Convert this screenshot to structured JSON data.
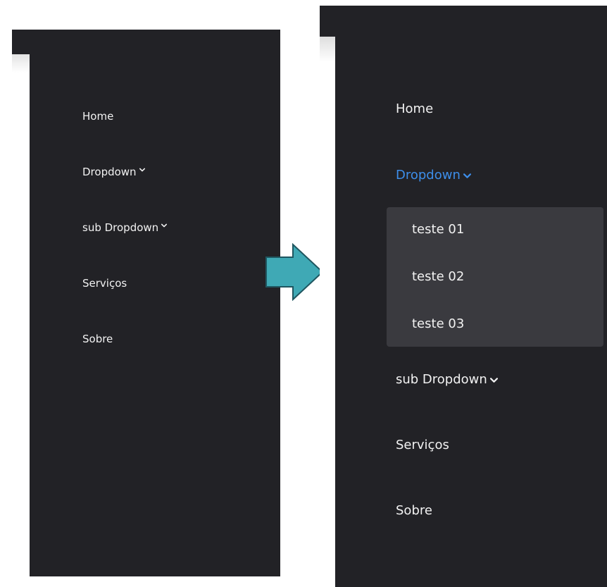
{
  "before": {
    "menu": [
      {
        "label": "Home",
        "has_chevron": false
      },
      {
        "label": "Dropdown",
        "has_chevron": true
      },
      {
        "label": "sub Dropdown",
        "has_chevron": true
      },
      {
        "label": "Serviços",
        "has_chevron": false
      },
      {
        "label": "Sobre",
        "has_chevron": false
      }
    ]
  },
  "after": {
    "menu": [
      {
        "label": "Home",
        "has_chevron": false
      },
      {
        "label": "Dropdown",
        "has_chevron": true,
        "active": true
      },
      {
        "label": "sub Dropdown",
        "has_chevron": true
      },
      {
        "label": "Serviços",
        "has_chevron": false
      },
      {
        "label": "Sobre",
        "has_chevron": false
      }
    ],
    "dropdown_items": [
      "teste 01",
      "teste 02",
      "teste 03"
    ]
  },
  "colors": {
    "panel_bg": "#222226",
    "dropdown_bg": "#3a3a3f",
    "text": "#f2f2f2",
    "active_text": "#3d8eea",
    "arrow_fill": "#3fa9b5",
    "arrow_stroke": "#1f5660"
  },
  "icons": {
    "chevron": "chevron-down-icon",
    "arrow": "arrow-right-icon"
  }
}
